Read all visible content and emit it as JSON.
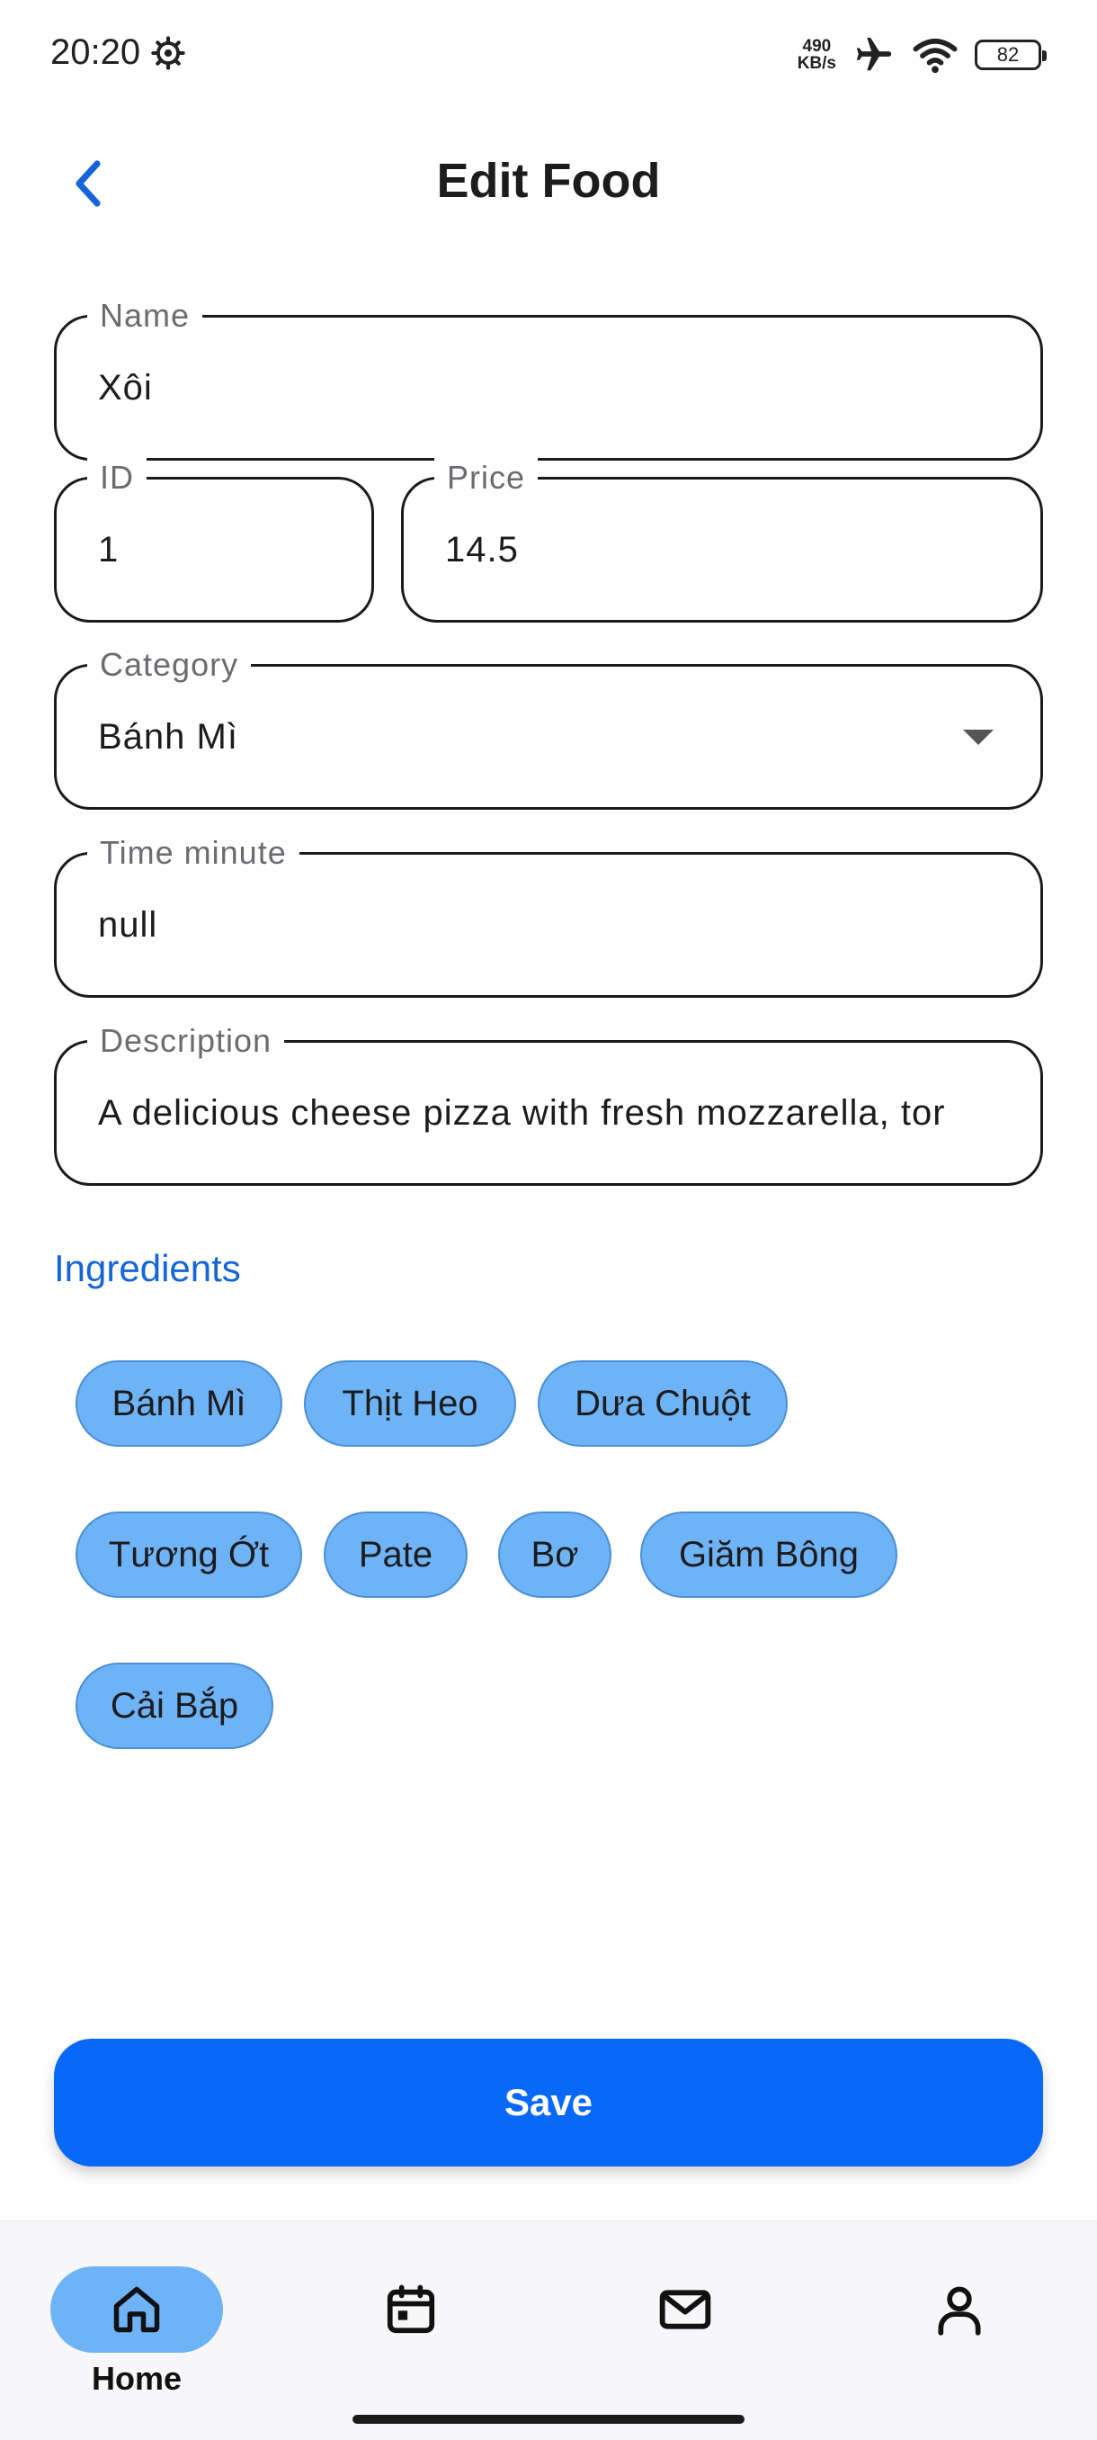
{
  "status_bar": {
    "time": "20:20",
    "net_speed_value": "490",
    "net_speed_unit": "KB/s",
    "battery": "82",
    "icons": [
      "settings-gear-icon",
      "airplane-icon",
      "wifi-icon",
      "battery-icon"
    ]
  },
  "header": {
    "title": "Edit Food",
    "back_icon": "chevron-left-icon"
  },
  "form": {
    "name": {
      "label": "Name",
      "value": "Xôi"
    },
    "id": {
      "label": "ID",
      "value": "1"
    },
    "price": {
      "label": "Price",
      "value": "14.5"
    },
    "category": {
      "label": "Category",
      "value": "Bánh Mì"
    },
    "time_minute": {
      "label": "Time minute",
      "value": "null"
    },
    "description": {
      "label": "Description",
      "value": "A delicious cheese pizza with fresh mozzarella, tor"
    }
  },
  "ingredients": {
    "title": "Ingredients",
    "chips": [
      "Bánh Mì",
      "Thịt Heo",
      "Dưa Chuột",
      "Tương Ớt",
      "Pate",
      "Bơ",
      "Giăm Bông",
      "Cải Bắp"
    ]
  },
  "save_label": "Save",
  "bottom_nav": {
    "items": [
      {
        "icon": "home-icon",
        "label": "Home",
        "active": true
      },
      {
        "icon": "calendar-icon",
        "label": "",
        "active": false
      },
      {
        "icon": "mail-icon",
        "label": "",
        "active": false
      },
      {
        "icon": "profile-icon",
        "label": "",
        "active": false
      }
    ]
  },
  "colors": {
    "primary": "#0868f8",
    "chip_fill": "#6fb3f7",
    "section_title": "#1565d8",
    "back_icon": "#1565d8"
  }
}
